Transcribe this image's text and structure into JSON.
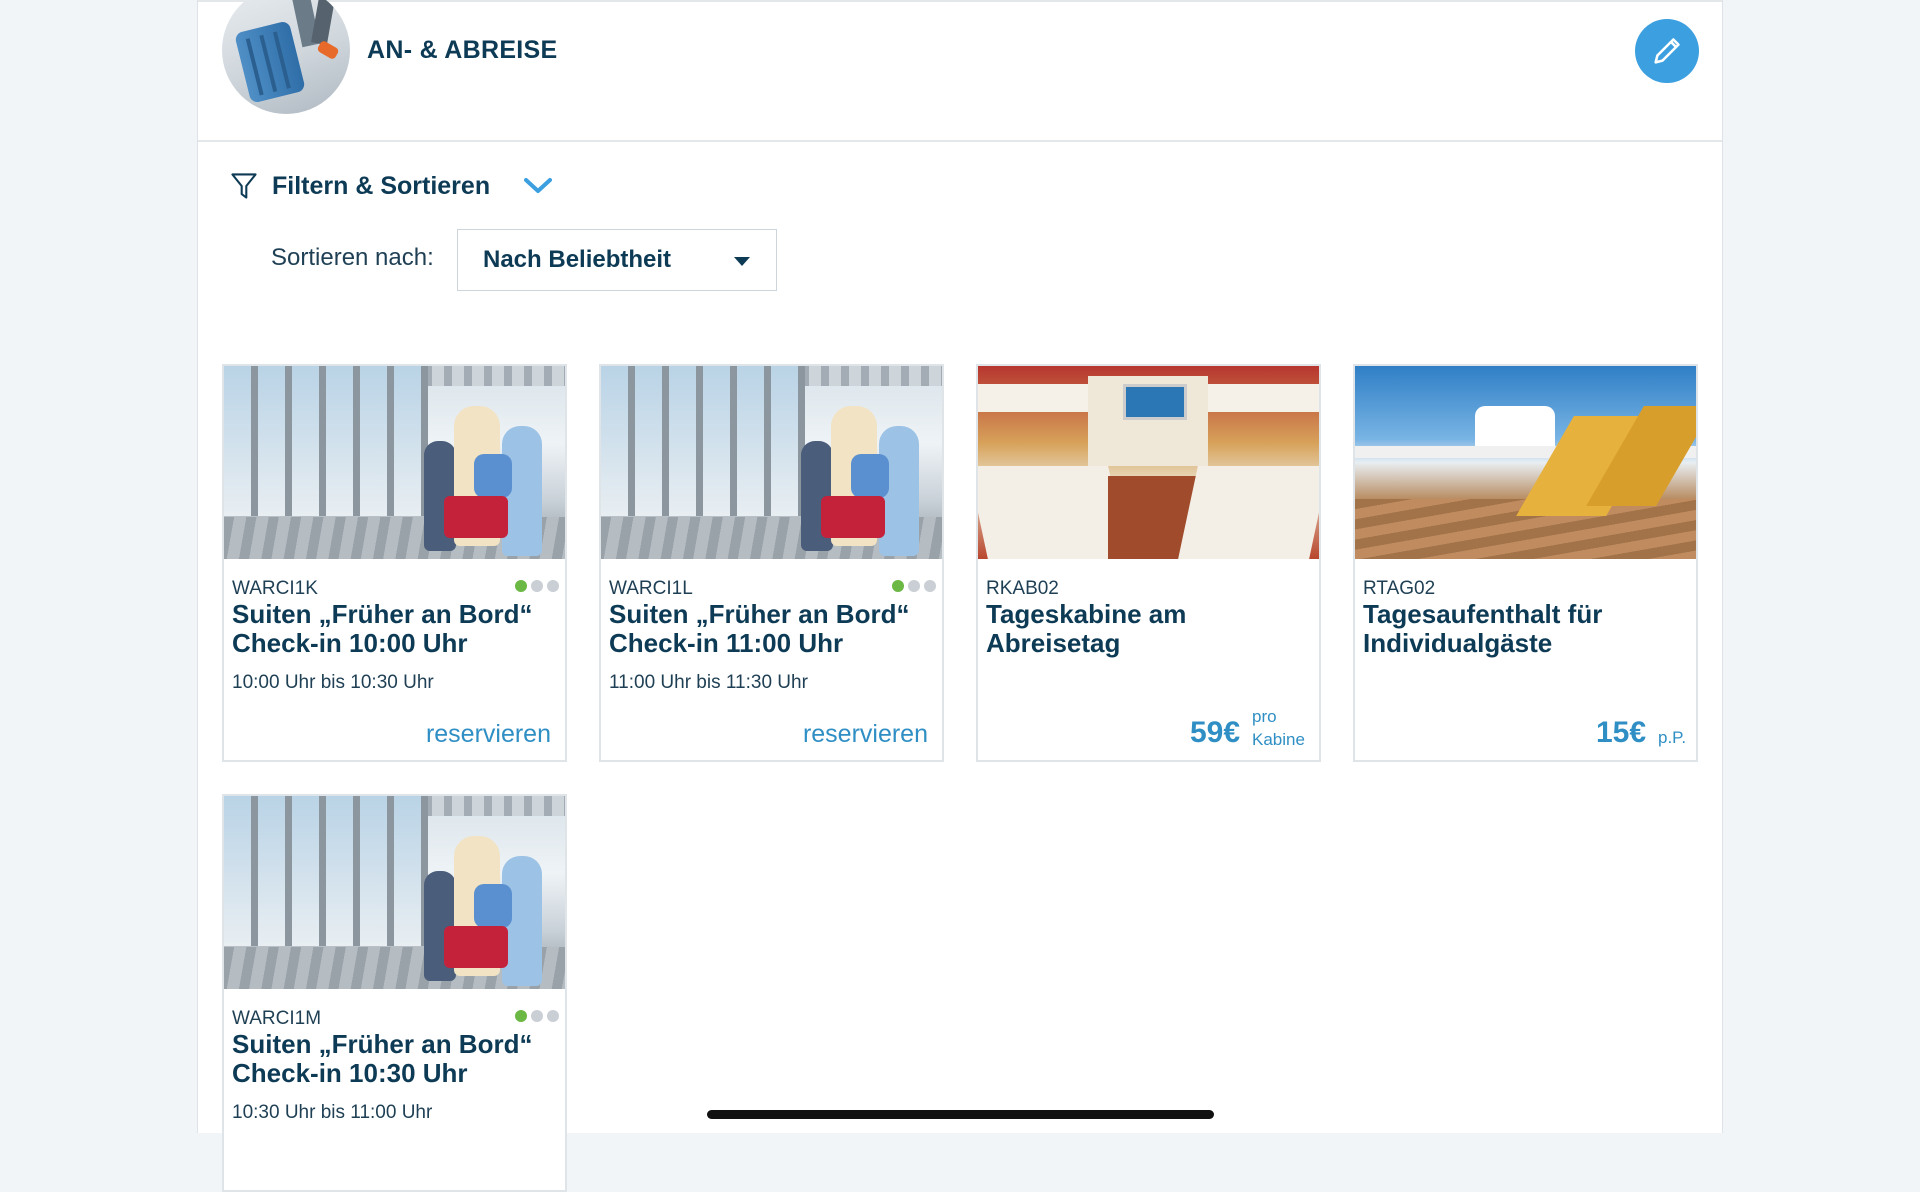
{
  "header": {
    "title": "AN- & ABREISE",
    "edit_icon": "pencil-icon"
  },
  "filter": {
    "label": "Filtern & Sortieren",
    "icon": "funnel-icon",
    "toggle_icon": "chevron-down-icon"
  },
  "sort": {
    "label": "Sortieren nach:",
    "value": "Nach Beliebtheit"
  },
  "colors": {
    "accent": "#2f8fc4",
    "primary_text": "#0d3a55",
    "dot_active": "#6cb845",
    "dot_inactive": "#c9cfd4"
  },
  "cards": [
    {
      "code": "WARCI1K",
      "title": "Suiten „Früher an Bord“ Check-in 10:00 Uhr",
      "time": "10:00 Uhr bis 10:30 Uhr",
      "action": "reservieren",
      "availability": "1 of 3"
    },
    {
      "code": "WARCI1L",
      "title": "Suiten „Früher an Bord“ Check-in 11:00 Uhr",
      "time": "11:00 Uhr bis 11:30 Uhr",
      "action": "reservieren",
      "availability": "1 of 3"
    },
    {
      "code": "RKAB02",
      "title": "Tageskabine am Abreisetag",
      "price": "59€",
      "price_unit_1": "pro",
      "price_unit_2": "Kabine"
    },
    {
      "code": "RTAG02",
      "title": "Tagesaufenthalt für Individualgäste",
      "price": "15€",
      "price_unit_1": "p.P."
    },
    {
      "code": "WARCI1M",
      "title": "Suiten „Früher an Bord“ Check-in 10:30 Uhr",
      "time": "10:30 Uhr bis 11:00 Uhr",
      "availability": "1 of 3"
    }
  ]
}
